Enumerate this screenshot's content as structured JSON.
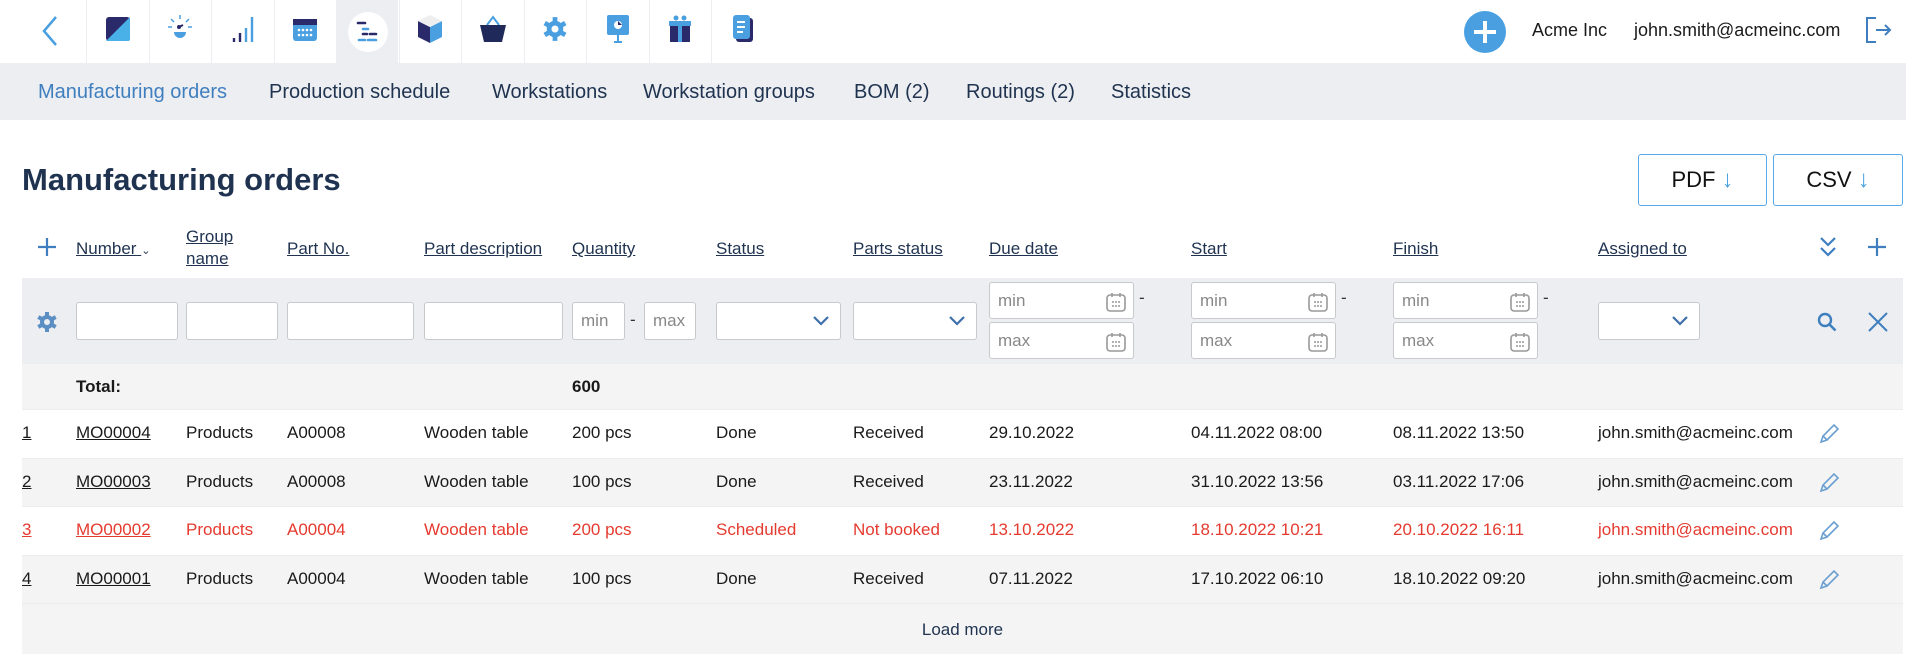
{
  "topbar": {
    "app_icons": [
      "back-icon",
      "dashboard-icon",
      "ideas-icon",
      "stats-icon",
      "calendar-icon",
      "production-icon",
      "inventory-icon",
      "sales-icon",
      "settings-icon",
      "presentation-icon",
      "gift-icon",
      "documents-icon"
    ],
    "company": "Acme Inc",
    "user": "john.smith@acmeinc.com",
    "accent": "#4a9fe0"
  },
  "subnav": {
    "items": [
      {
        "label": "Manufacturing orders",
        "active": true
      },
      {
        "label": "Production schedule"
      },
      {
        "label": "Workstations"
      },
      {
        "label": "Workstation groups"
      },
      {
        "label": "BOM (2)"
      },
      {
        "label": "Routings (2)"
      },
      {
        "label": "Statistics"
      }
    ]
  },
  "page": {
    "title": "Manufacturing orders",
    "pdf_label": "PDF",
    "csv_label": "CSV"
  },
  "table": {
    "headers": {
      "number": "Number",
      "group_name": "Group name",
      "part_no": "Part No.",
      "part_description": "Part description",
      "quantity": "Quantity",
      "status": "Status",
      "parts_status": "Parts status",
      "due_date": "Due date",
      "start": "Start",
      "finish": "Finish",
      "assigned_to": "Assigned to"
    },
    "filters": {
      "min_placeholder": "min",
      "max_placeholder": "max",
      "range_sep": "-"
    },
    "total_label": "Total:",
    "total_quantity": "600",
    "rows": [
      {
        "idx": "1",
        "number": "MO00004",
        "group": "Products",
        "part_no": "A00008",
        "desc": "Wooden table",
        "qty": "200 pcs",
        "status": "Done",
        "parts_status": "Received",
        "due": "29.10.2022",
        "start": "04.11.2022 08:00",
        "finish": "08.11.2022 13:50",
        "assigned": "john.smith@acmeinc.com",
        "highlight": false
      },
      {
        "idx": "2",
        "number": "MO00003",
        "group": "Products",
        "part_no": "A00008",
        "desc": "Wooden table",
        "qty": "100 pcs",
        "status": "Done",
        "parts_status": "Received",
        "due": "23.11.2022",
        "start": "31.10.2022 13:56",
        "finish": "03.11.2022 17:06",
        "assigned": "john.smith@acmeinc.com",
        "highlight": false
      },
      {
        "idx": "3",
        "number": "MO00002",
        "group": "Products",
        "part_no": "A00004",
        "desc": "Wooden table",
        "qty": "200 pcs",
        "status": "Scheduled",
        "parts_status": "Not booked",
        "due": "13.10.2022",
        "start": "18.10.2022 10:21",
        "finish": "20.10.2022 16:11",
        "assigned": "john.smith@acmeinc.com",
        "highlight": true
      },
      {
        "idx": "4",
        "number": "MO00001",
        "group": "Products",
        "part_no": "A00004",
        "desc": "Wooden table",
        "qty": "100 pcs",
        "status": "Done",
        "parts_status": "Received",
        "due": "07.11.2022",
        "start": "17.10.2022 06:10",
        "finish": "18.10.2022 09:20",
        "assigned": "john.smith@acmeinc.com",
        "highlight": false
      }
    ],
    "load_more": "Load more",
    "highlight_color": "#e53a2f"
  }
}
